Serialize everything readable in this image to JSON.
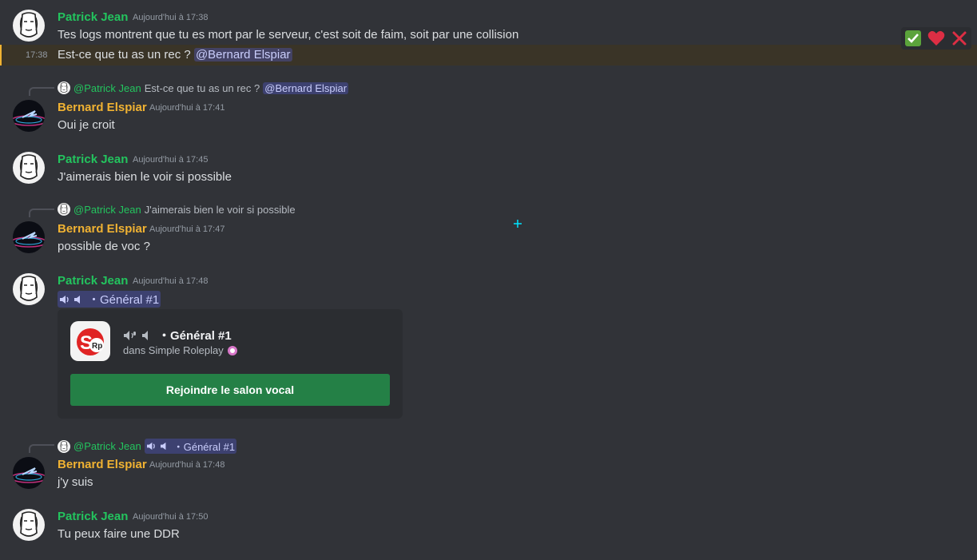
{
  "colors": {
    "background": "#313338",
    "author_patrick": "#23c45e",
    "author_bernard": "#f0b232",
    "mention_bg": "#3c4270",
    "join_button": "#248046"
  },
  "reactions": [
    {
      "icon": "check-mark-icon"
    },
    {
      "icon": "heart-icon"
    },
    {
      "icon": "cross-mark-icon"
    }
  ],
  "messages": {
    "m1": {
      "author": "Patrick Jean",
      "timestamp": "Aujourd'hui à 17:38",
      "line1": "Tes logs montrent que tu es mort par le serveur, c'est soit de faim, soit par une collision",
      "line2_time": "17:38",
      "line2": "Est-ce que tu as un rec ?",
      "line2_mention": "@Bernard Elspiar"
    },
    "m2": {
      "reply_author": "@Patrick Jean",
      "reply_text": "Est-ce que tu as un rec ?",
      "reply_mention": "@Bernard Elspiar",
      "author": "Bernard Elspiar",
      "timestamp": "Aujourd'hui à 17:41",
      "text": "Oui je croit"
    },
    "m3": {
      "author": "Patrick Jean",
      "timestamp": "Aujourd'hui à 17:45",
      "text": "J'aimerais bien le voir si possible"
    },
    "m4": {
      "reply_author": "@Patrick Jean",
      "reply_text": "J'aimerais bien le voir si possible",
      "author": "Bernard Elspiar",
      "timestamp": "Aujourd'hui à 17:47",
      "text": "possible de voc ?"
    },
    "m5": {
      "author": "Patrick Jean",
      "timestamp": "Aujourd'hui à 17:48",
      "channel_mention": "・Général #1",
      "embed": {
        "channel_name": "・Général #1",
        "server_line": "dans Simple Roleplay",
        "join_label": "Rejoindre le salon vocal",
        "logo_text": "SRP"
      }
    },
    "m6": {
      "reply_author": "@Patrick Jean",
      "reply_channel": "・Général #1",
      "author": "Bernard Elspiar",
      "timestamp": "Aujourd'hui à 17:48",
      "text": "j'y suis"
    },
    "m7": {
      "author": "Patrick Jean",
      "timestamp": "Aujourd'hui à 17:50",
      "text": "Tu peux faire une DDR"
    }
  }
}
